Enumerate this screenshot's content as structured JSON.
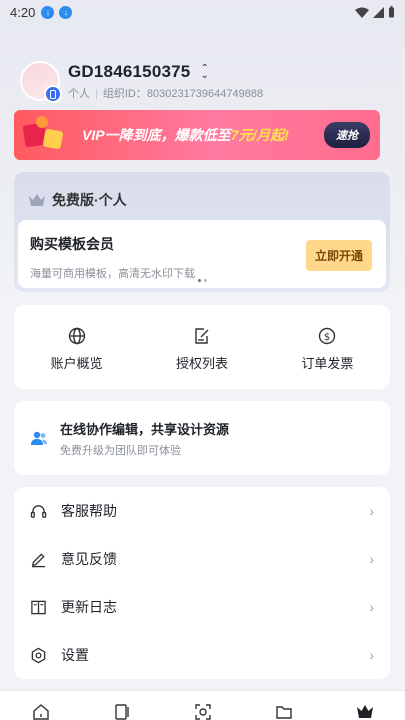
{
  "status_bar": {
    "time": "4:20"
  },
  "profile": {
    "name": "GD1846150375",
    "type": "个人",
    "org_label": "组织ID：",
    "org_id": "803023173964474988​8"
  },
  "vip_banner": {
    "text_prefix": "VIP一降到底，爆款低至",
    "text_highlight": "7元/月起!",
    "button": "速抢"
  },
  "plan": {
    "title": "免费版·个人",
    "buy_title": "购买模板会员",
    "buy_desc": "海量可商用模板，高清无水印下载",
    "buy_button": "立即开通"
  },
  "quick_actions": [
    {
      "label": "账户概览",
      "icon": "globe-icon"
    },
    {
      "label": "授权列表",
      "icon": "edit-doc-icon"
    },
    {
      "label": "订单发票",
      "icon": "dollar-icon"
    }
  ],
  "team": {
    "title": "在线协作编辑，共享设计资源",
    "desc": "免费升级为团队即可体验"
  },
  "menu": [
    {
      "label": "客服帮助",
      "icon": "headset-icon"
    },
    {
      "label": "意见反馈",
      "icon": "pencil-icon"
    },
    {
      "label": "更新日志",
      "icon": "book-icon"
    },
    {
      "label": "设置",
      "icon": "settings-icon"
    }
  ],
  "tabs": [
    "home-icon",
    "template-icon",
    "scan-icon",
    "folder-icon",
    "crown-icon"
  ],
  "colors": {
    "accent": "#2d8cf0",
    "vip_gradient_start": "#ff5a5f",
    "open_button": "#ffd88a"
  }
}
